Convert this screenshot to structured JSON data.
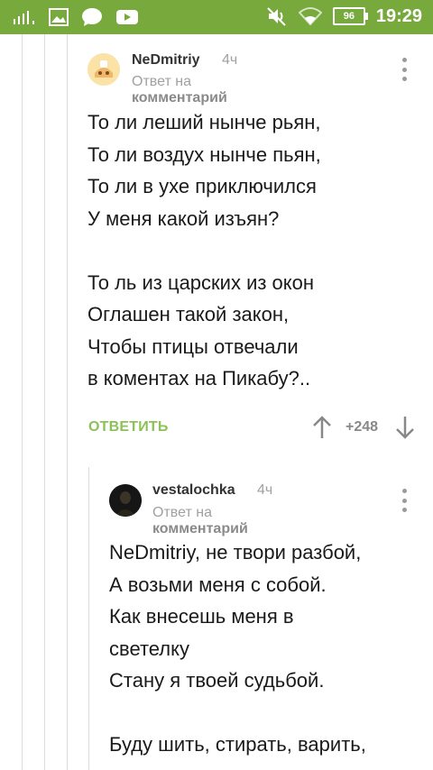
{
  "status_bar": {
    "time": "19:29",
    "battery": "96"
  },
  "comments": [
    {
      "author": "NeDmitriy",
      "time": "4ч",
      "reply_prefix": "Ответ на",
      "reply_target": "комментарий",
      "body": "То ли леший нынче рьян,\nТо ли воздух нынче пьян,\nТо ли в ухе приключился\nУ меня какой изъян?\n\nТо ль из царских из окон\nОглашен такой закон,\nЧтобы птицы отвечали\nв коментах на Пикабу?..",
      "reply_label": "ОТВЕТИТЬ",
      "rating": "+248"
    },
    {
      "author": "vestalochka",
      "time": "4ч",
      "reply_prefix": "Ответ на",
      "reply_target": "комментарий",
      "body": "NeDmitriy, не твори разбой,\nА возьми меня с собой.\nКак внесешь меня в\nсветелку\nСтану я твоей судьбой.\n\nБуду шить, стирать, варить,"
    }
  ],
  "colors": {
    "status_bar": "#77a93d",
    "reply_button": "#8cc158"
  }
}
